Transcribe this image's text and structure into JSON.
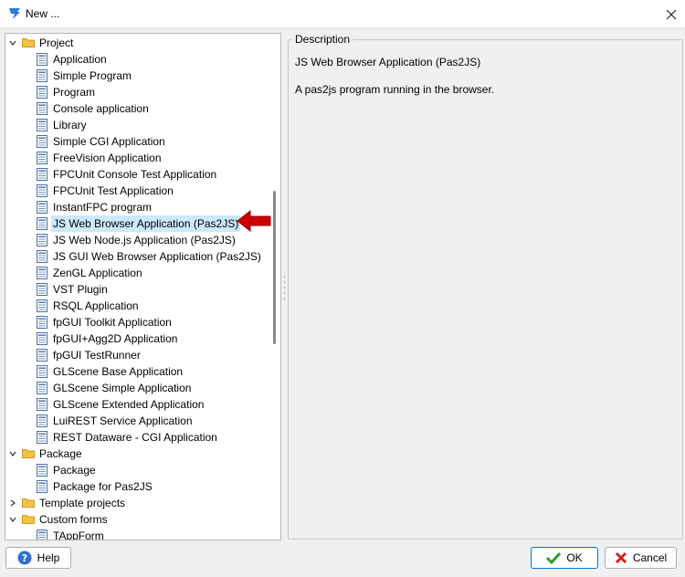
{
  "window": {
    "title": "New ..."
  },
  "tree": {
    "rows": [
      {
        "label": "Project",
        "kind": "folder",
        "level": 0,
        "expanded": true
      },
      {
        "label": "Application",
        "kind": "file",
        "level": 1
      },
      {
        "label": "Simple Program",
        "kind": "file",
        "level": 1
      },
      {
        "label": "Program",
        "kind": "file",
        "level": 1
      },
      {
        "label": "Console application",
        "kind": "file",
        "level": 1
      },
      {
        "label": "Library",
        "kind": "file",
        "level": 1
      },
      {
        "label": "Simple CGI Application",
        "kind": "file",
        "level": 1
      },
      {
        "label": "FreeVision Application",
        "kind": "file",
        "level": 1
      },
      {
        "label": "FPCUnit Console Test Application",
        "kind": "file",
        "level": 1
      },
      {
        "label": "FPCUnit Test Application",
        "kind": "file",
        "level": 1
      },
      {
        "label": "InstantFPC program",
        "kind": "file",
        "level": 1
      },
      {
        "label": "JS Web Browser Application (Pas2JS)",
        "kind": "file",
        "level": 1,
        "selected": true
      },
      {
        "label": "JS Web Node.js Application (Pas2JS)",
        "kind": "file",
        "level": 1
      },
      {
        "label": "JS GUI Web Browser Application (Pas2JS)",
        "kind": "file",
        "level": 1
      },
      {
        "label": "ZenGL Application",
        "kind": "file",
        "level": 1
      },
      {
        "label": "VST Plugin",
        "kind": "file",
        "level": 1
      },
      {
        "label": "RSQL Application",
        "kind": "file",
        "level": 1
      },
      {
        "label": "fpGUI Toolkit Application",
        "kind": "file",
        "level": 1
      },
      {
        "label": "fpGUI+Agg2D Application",
        "kind": "file",
        "level": 1
      },
      {
        "label": "fpGUI TestRunner",
        "kind": "file",
        "level": 1
      },
      {
        "label": "GLScene Base Application",
        "kind": "file",
        "level": 1
      },
      {
        "label": "GLScene Simple Application",
        "kind": "file",
        "level": 1
      },
      {
        "label": "GLScene Extended Application",
        "kind": "file",
        "level": 1
      },
      {
        "label": "LuiREST Service Application",
        "kind": "file",
        "level": 1
      },
      {
        "label": "REST Dataware - CGI Application",
        "kind": "file",
        "level": 1
      },
      {
        "label": "Package",
        "kind": "folder",
        "level": 0,
        "expanded": true
      },
      {
        "label": "Package",
        "kind": "file",
        "level": 1
      },
      {
        "label": "Package for Pas2JS",
        "kind": "file",
        "level": 1
      },
      {
        "label": "Template projects",
        "kind": "folder",
        "level": 0,
        "expanded": false
      },
      {
        "label": "Custom forms",
        "kind": "folder",
        "level": 0,
        "expanded": true
      },
      {
        "label": "TAppForm",
        "kind": "file",
        "level": 1
      }
    ]
  },
  "description": {
    "legend": "Description",
    "title": "JS Web Browser Application (Pas2JS)",
    "body": "A pas2js program running in the browser."
  },
  "buttons": {
    "help": "Help",
    "ok": "OK",
    "cancel": "Cancel"
  },
  "colors": {
    "selection": "#cce8ff",
    "folder": "#f5c242",
    "accent": "#0078d7",
    "arrow": "#cc0000",
    "ok_check": "#2e9c2e",
    "cancel_x": "#d42020",
    "help_icon": "#2f6fd0"
  },
  "icons": {
    "app": "lazarus-icon",
    "close": "close-icon",
    "folder": "folder-icon",
    "file": "form-file-icon",
    "arrow": "red-arrow-icon"
  }
}
